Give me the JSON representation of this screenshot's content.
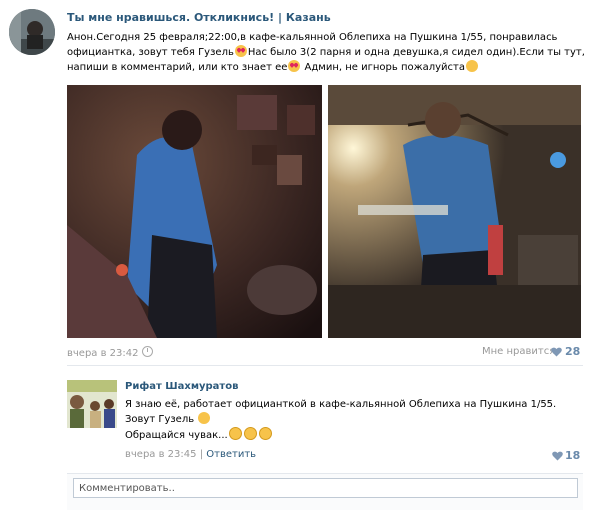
{
  "post": {
    "group_name": "Ты мне нравишься. Откликнись!",
    "separator": "|",
    "city": "Казань",
    "text_1": "Анон.Сегодня 25 февраля;22:00,в кафе-кальянной Облепиха на Пушкина 1/55, понравилась официантка, зовут тебя Гузель",
    "text_2": "Нас было 3(2 парня и одна девушка,я сидел один).Если ты тут, напиши в комментарий, или кто знает ее",
    "text_3": " Админ, не игнорь пожалуйста",
    "date": "вчера в 23:42",
    "like_label": "Мне нравится",
    "like_count": "28"
  },
  "comment": {
    "author": "Рифат Шахмуратов",
    "text_1": "Я знаю её, работает официанткой в кафе-кальянной Облепиха на Пушкина 1/55. Зовут Гузель",
    "text_2": "Обращайся чувак...",
    "date": "вчера в 23:45",
    "separator": "|",
    "reply_label": "Ответить",
    "like_count": "18"
  },
  "reply": {
    "placeholder": "Комментировать.."
  },
  "icons": {
    "heart_color": "#7f98b5",
    "emoji_heart_eyes": "heart-eyes",
    "emoji_pensive": "pensive",
    "emoji_joy": "joy",
    "emoji_smile": "smile"
  },
  "colors": {
    "link": "#2b587a",
    "meta": "#999999",
    "like_count": "#6a8aab"
  }
}
